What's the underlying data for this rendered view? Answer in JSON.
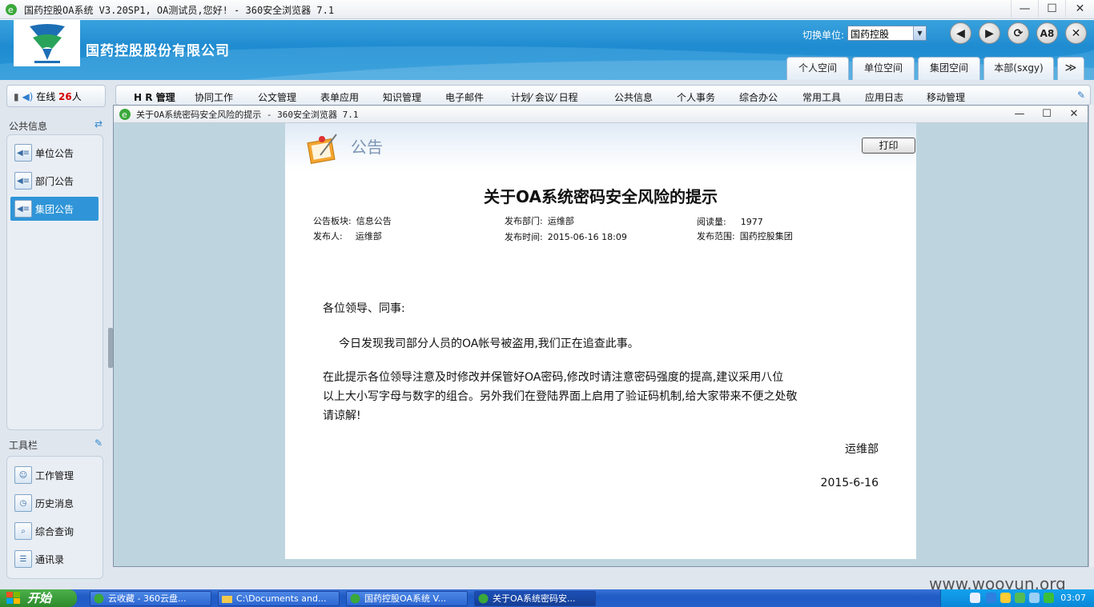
{
  "browser": {
    "title": "国药控股OA系统 V3.20SP1, OA测试员,您好! - 360安全浏览器 7.1",
    "controls": {
      "minimize": "—",
      "maximize": "☐",
      "close": "✕"
    }
  },
  "header": {
    "company": "国药控股股份有限公司",
    "switch_unit_label": "切换单位:",
    "switch_unit_value": "国药控股",
    "nav_buttons": [
      "back",
      "forward",
      "refresh",
      "A8",
      "close"
    ],
    "nav_labels": {
      "back": "◀",
      "forward": "▶",
      "refresh": "⟳",
      "a8": "A8",
      "close": "✕"
    },
    "tabs": [
      "个人空间",
      "单位空间",
      "集团空间",
      "本部(sxgy)"
    ],
    "more": "≫"
  },
  "online": {
    "label": "在线",
    "count": "26",
    "suffix": "人"
  },
  "menu": [
    "H R 管理",
    "协同工作",
    "公文管理",
    "表单应用",
    "知识管理",
    "电子邮件",
    "计划⁄ 会议⁄ 日程",
    "公共信息",
    "个人事务",
    "综合办公",
    "常用工具",
    "应用日志",
    "移动管理"
  ],
  "sidebar": {
    "public_info_title": "公共信息",
    "public_items": [
      "单位公告",
      "部门公告",
      "集团公告"
    ],
    "active_index": 2,
    "toolbar_title": "工具栏",
    "tool_items": [
      "工作管理",
      "历史消息",
      "综合查询",
      "通讯录"
    ]
  },
  "popup": {
    "title": "关于OA系统密码安全风险的提示 - 360安全浏览器 7.1",
    "banner_label": "公告",
    "print": "打印",
    "doc_title": "关于OA系统密码安全风险的提示",
    "meta": {
      "board_label": "公告板块:",
      "board": "信息公告",
      "dept_label": "发布部门:",
      "dept": "运维部",
      "reads_label": "阅读量:",
      "reads": "1977",
      "publisher_label": "发布人:",
      "publisher": "运维部",
      "time_label": "发布时间:",
      "time": "2015-06-16 18:09",
      "scope_label": "发布范围:",
      "scope": "国药控股集团"
    },
    "greeting": "各位领导、同事:",
    "para1": "今日发现我司部分人员的OA帐号被盗用,我们正在追查此事。",
    "para2_line1": "在此提示各位领导注意及时修改并保管好OA密码,修改时请注意密码强度的提高,建议采用八位",
    "para2_line2": "以上大小写字母与数字的组合。另外我们在登陆界面上启用了验证码机制,给大家带来不便之处敬",
    "para2_line3": "请谅解!",
    "signature": "运维部",
    "date": "2015-6-16"
  },
  "taskbar": {
    "start": "开始",
    "items": [
      "云收藏 - 360云盘...",
      "C:\\Documents and...",
      "国药控股OA系统 V...",
      "关于OA系统密码安..."
    ],
    "clock": "03:07"
  },
  "watermark": "www.wooyun.org",
  "colors": {
    "header_blue": "#2a98d8",
    "active_item": "#2f95d8",
    "online_count": "#d40000"
  }
}
